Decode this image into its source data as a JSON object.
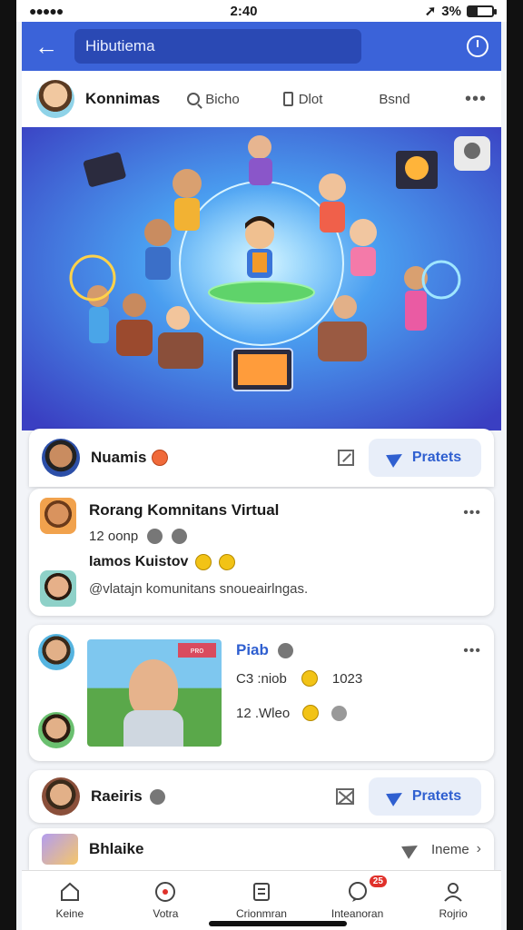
{
  "status": {
    "time": "2:40",
    "battery": "3%"
  },
  "header": {
    "search_value": "Hibutiema"
  },
  "community": {
    "name": "Konnimas",
    "tools": [
      "Bicho",
      "Dlot",
      "Bsnd"
    ]
  },
  "post1": {
    "author": "Nuamis",
    "share_label": "Pratets"
  },
  "post2": {
    "title": "Rorang Komnitans Virtual",
    "count": "12 oonp",
    "subtitle": "Iamos Kuistov",
    "caption": "@vlatajn komunitans snoueairlngas."
  },
  "post3": {
    "name": "Piab",
    "stat1": "C3 :niob",
    "stat1_value": "1023",
    "stat2": "12 .Wleo",
    "sign": "ᴘʀᴏ"
  },
  "post4": {
    "author": "Raeiris",
    "share_label": "Pratets"
  },
  "post5": {
    "title": "Bhlaike",
    "link_label": "Ineme"
  },
  "nav": {
    "items": [
      "Keine",
      "Votra",
      "Crionmran",
      "Inteanoran",
      "Rojrio"
    ],
    "badge": "25"
  },
  "colors": {
    "primary": "#3b63d9",
    "accent": "#2f5fd0",
    "badge": "#e0312b"
  }
}
